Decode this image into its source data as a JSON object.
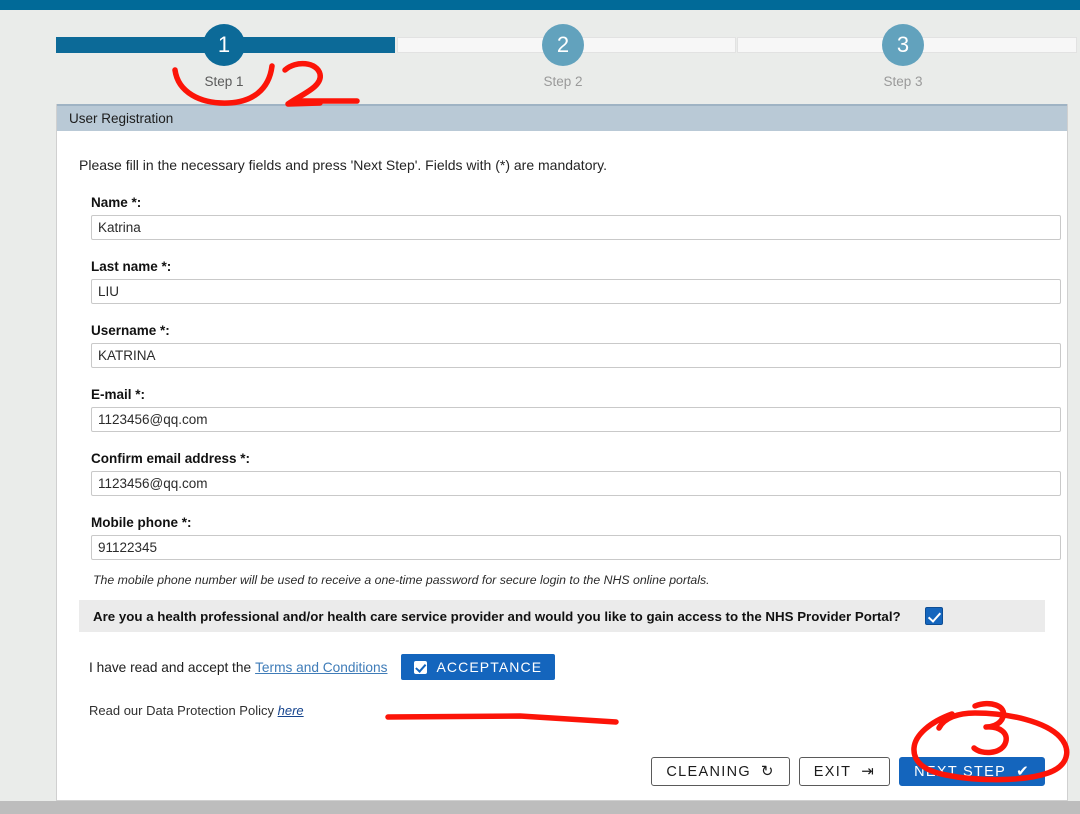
{
  "theme": {
    "topbar_color": "#016a98",
    "page_bg": "#eaecea",
    "panel_header_bg": "#b9c9d6",
    "active_step_color": "#0c6a98",
    "inactive_step_color": "#62a2bd",
    "primary_button_color": "#1465bd",
    "link_color": "#3f7cb8",
    "annotation_color": "#ff0000"
  },
  "stepper": {
    "steps": [
      {
        "number": "1",
        "label": "Step 1",
        "state": "active"
      },
      {
        "number": "2",
        "label": "Step 2",
        "state": "inactive"
      },
      {
        "number": "3",
        "label": "Step 3",
        "state": "inactive"
      }
    ]
  },
  "panel": {
    "title": "User Registration",
    "intro": "Please fill in the necessary fields and press 'Next Step'. Fields with (*) are mandatory.",
    "fields": [
      {
        "label": "Name *:",
        "value": "Katrina",
        "placeholder": ""
      },
      {
        "label": "Last name *:",
        "value": "LIU",
        "placeholder": ""
      },
      {
        "label": "Username *:",
        "value": "KATRINA",
        "placeholder": ""
      },
      {
        "label": "E-mail *:",
        "value": "1123456@qq.com",
        "placeholder": ""
      },
      {
        "label": "Confirm email address *:",
        "value": "1123456@qq.com",
        "placeholder": ""
      },
      {
        "label": "Mobile phone *:",
        "value": "91122345",
        "placeholder": ""
      }
    ],
    "mobile_note": "The mobile phone number will be used to receive a one-time password for secure login to the NHS online portals.",
    "provider_question": {
      "text": "Are you a health professional and/or health care service provider and would you like to gain access to the NHS Provider Portal?",
      "checked": true
    },
    "terms": {
      "prefix": "I have read and accept the",
      "link_label": "Terms and Conditions",
      "accept_button_label": "ACCEPTANCE",
      "accept_checked": true
    },
    "data_protection": {
      "prefix": "Read our Data Protection Policy",
      "link_label": "here"
    }
  },
  "footer": {
    "buttons": [
      {
        "label": "CLEANING",
        "icon": "refresh-icon",
        "glyph": "↻",
        "style": "outline"
      },
      {
        "label": "EXIT",
        "icon": "sign-out-icon",
        "glyph": "⇥",
        "style": "outline"
      },
      {
        "label": "NEXT STEP",
        "icon": "check-icon",
        "glyph": "✔",
        "style": "primary"
      }
    ]
  },
  "annotations": [
    {
      "name": "annotation-number-2",
      "text": "2"
    },
    {
      "name": "annotation-number-3",
      "text": "3"
    }
  ]
}
